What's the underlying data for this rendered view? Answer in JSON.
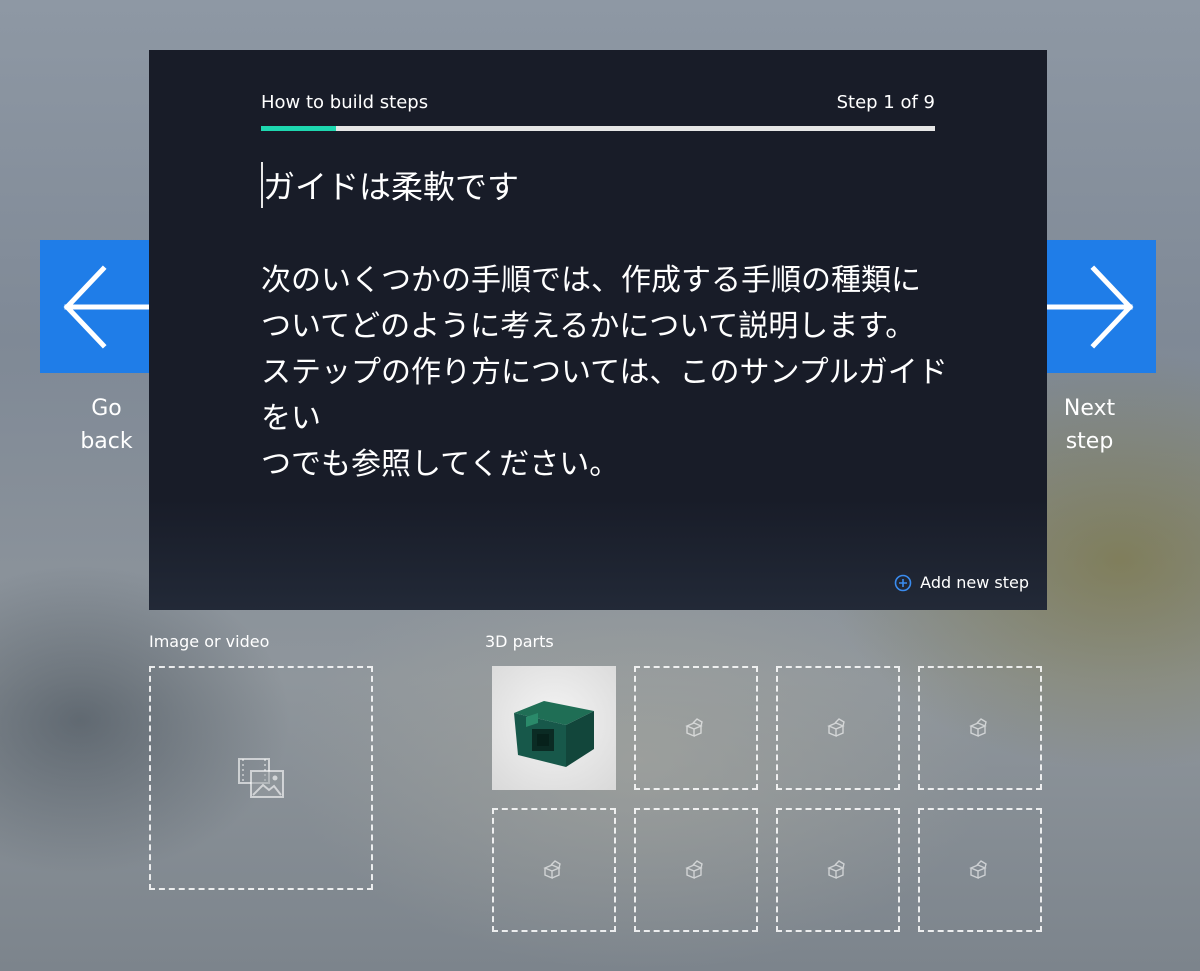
{
  "header": {
    "title": "How to build steps",
    "step_counter": "Step 1 of 9",
    "progress_fraction": 0.111
  },
  "step": {
    "title": "ガイドは柔軟です",
    "body": "次のいくつかの手順では、作成する手順の種類に\nついてどのように考えるかについて説明します。\nステップの作り方については、このサンプルガイドをい\nつでも参照してください。"
  },
  "actions": {
    "add_step": "Add new step"
  },
  "nav": {
    "back_label": "Go\nback",
    "next_label": "Next\nstep"
  },
  "media": {
    "image_label": "Image or video",
    "parts_label": "3D parts"
  },
  "colors": {
    "accent": "#1f7de8",
    "progress": "#1ed7b0",
    "panel": "#181c28"
  }
}
